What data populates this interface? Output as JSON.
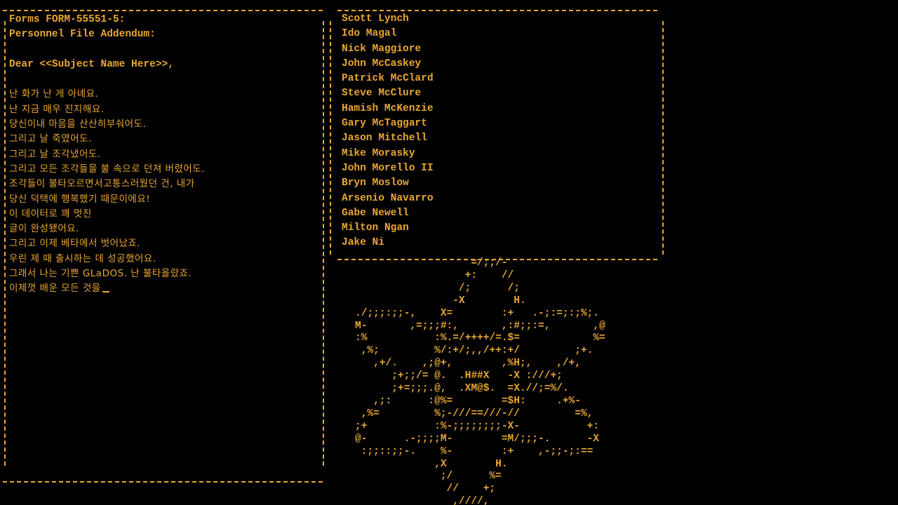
{
  "colors": {
    "background": "#000000",
    "text": "#e8a733"
  },
  "letter": {
    "form_id": "Forms FORM-55551-5:",
    "form_title": "Personnel File Addendum:",
    "greeting": "Dear <<Subject Name Here>>,",
    "lines": [
      "난 화가 난 게 아녜요.",
      "난 지금 매우 진지해요.",
      "당신이내 마음을 산산히부숴어도.",
      "그리고 날 죽였어도.",
      "그리고 날 조각냈어도.",
      "그리고 모든 조각들을 불 속으로 던져 버렸어도.",
      "조각들이 불타오르면서고통스러웠던 건, 내가",
      "당신 덕택에 행복했기 때문이에요!",
      "이 데이터로 꽤 멋진",
      "글이 완성됐어요.",
      "그리고 이제 베타에서 벗어났죠.",
      "우린 제 때 출시하는 데 성공했어요.",
      "그래서 나는 기쁜 GLaDOS. 난 불타올랐죠.",
      "이제껏 배운 모든 것을"
    ]
  },
  "credits": {
    "names": [
      "Scott Lynch",
      "Ido Magal",
      "Nick Maggiore",
      "John McCaskey",
      "Patrick McClard",
      "Steve McClure",
      "Hamish McKenzie",
      "Gary McTaggart",
      "Jason Mitchell",
      "Mike Morasky",
      "John Morello II",
      "Bryn Moslow",
      "Arsenio Navarro",
      "Gabe Newell",
      "Milton Ngan",
      "Jake Ni"
    ]
  },
  "ascii_art": {
    "icon": "aperture-logo-ascii",
    "text": "                   =/;;/-\n                  +:    //\n                 /;      /;\n                -X        H.\n./;;;:;;-,    X=        :+   .-;:=;:;%;.\nM-       ,=;;;#:,       ,:#;;:=,       ,@\n:%           :%.=/++++/=.$=            %=\n ,%;         %/:+/;,,/++:+/         ;+.\n   ,+/.    ,;@+,        ,%H;,    ,/+,\n      ;+;;/= @.  .H##X   -X :///+;\n      ;+=;;;.@,  .XM@$.  =X.//;=%/.\n   ,;:      :@%=        =$H:     .+%-\n ,%=         %;-///==///-//         =%,\n;+           :%-;;;;;;;;-X-           +:\n@-      .-;;;;M-        =M/;;;-.      -X\n :;;::;;-.    %-        :+    ,-;;-;:==\n             ,X        H.\n              ;/      %=\n               //    +;\n                ,////,"
  }
}
